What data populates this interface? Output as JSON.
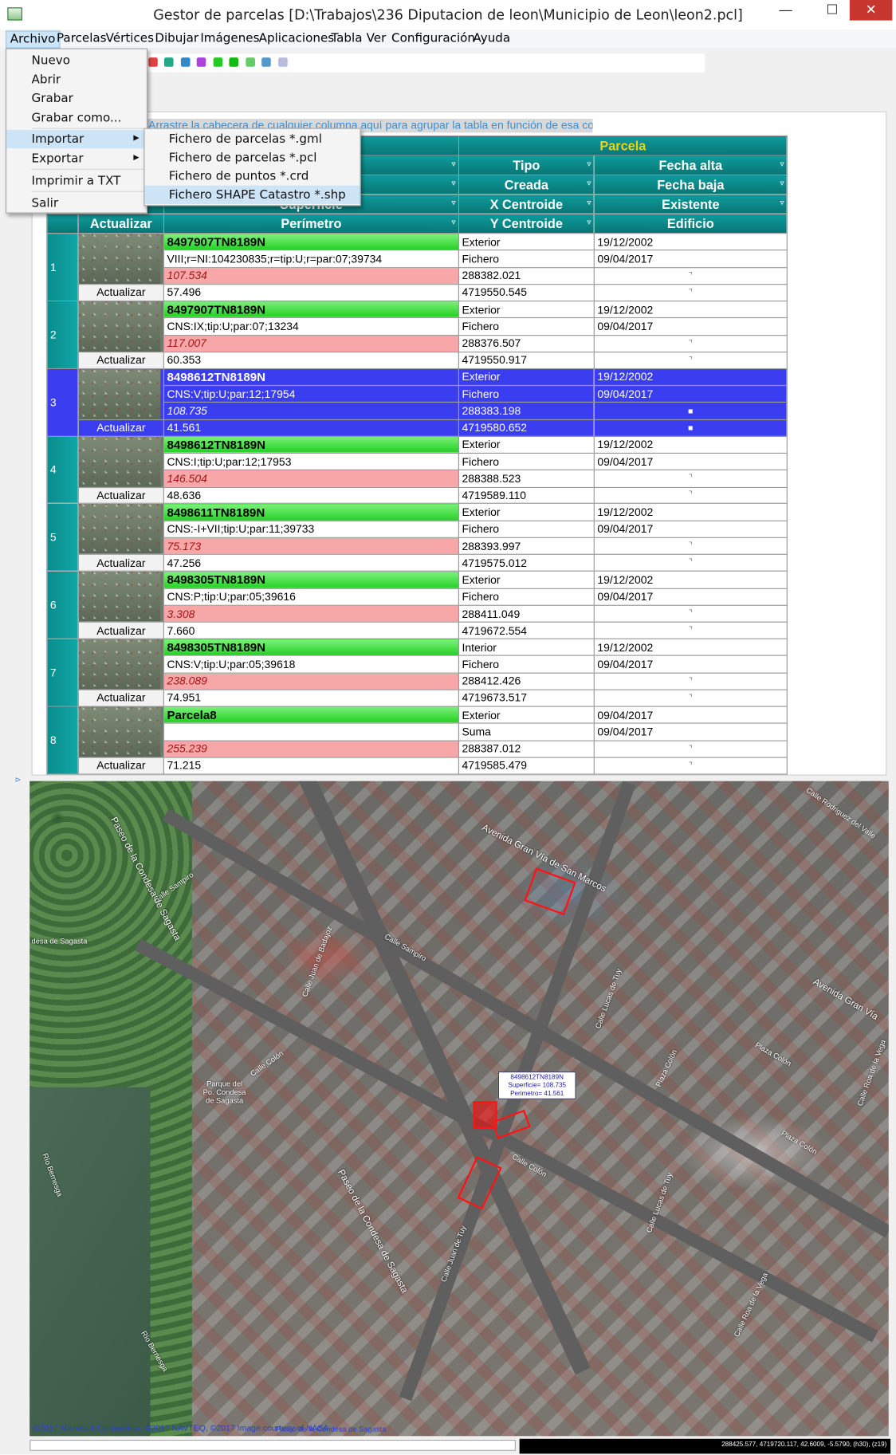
{
  "window": {
    "title": "Gestor de parcelas [D:\\Trabajos\\236 Diputacion de leon\\Municipio de Leon\\leon2.pcl]",
    "minimize": "—",
    "maximize": "☐",
    "close": "✕"
  },
  "menubar": [
    "Archivo",
    "Parcelas",
    "Vértices",
    "Dibujar",
    "Imágenes",
    "Aplicaciones",
    "Tabla",
    "Ver",
    "Configuración",
    "Ayuda"
  ],
  "archivo_menu": {
    "items": [
      "Nuevo",
      "Abrir",
      "Grabar",
      "Grabar como...",
      "Importar",
      "Exportar",
      "Imprimir a TXT",
      "Salir"
    ],
    "highlighted": "Importar"
  },
  "importar_submenu": {
    "items": [
      "Fichero de parcelas *.gml",
      "Fichero de parcelas *.pcl",
      "Fichero de puntos *.crd",
      "Fichero SHAPE Catastro *.shp"
    ],
    "highlighted": "Fichero SHAPE Catastro *.shp"
  },
  "group_hint": "Arrastre la cabecera de cualquier columna aquí para agrupar la tabla en función de esa columna.",
  "grid": {
    "band": "Parcela",
    "headers": {
      "tipo": "Tipo",
      "fecha_alta": "Fecha alta",
      "creada": "Creada",
      "fecha_baja": "Fecha baja",
      "superficie": "Superficie",
      "x_centroide": "X Centroide",
      "existente": "Existente",
      "actualizar": "Actualizar",
      "perimetro": "Perímetro",
      "y_centroide": "Y Centroide",
      "edificio": "Edificio"
    },
    "rows": [
      {
        "n": "1",
        "ref": "8497907TN8189N",
        "desc": "VIII;r=NI:104230835;r=tip:U;r=par:07;39734",
        "area": "107.534",
        "perim": "57.496",
        "tipo": "Exterior",
        "creada": "Fichero",
        "x": "288382.021",
        "y": "4719550.545",
        "alta": "19/12/2002",
        "baja": "09/04/2017",
        "upd": "Actualizar",
        "chk1": "⌝",
        "chk2": "⌝"
      },
      {
        "n": "2",
        "ref": "8497907TN8189N",
        "desc": "CNS:IX;tip:U;par:07;13234",
        "area": "117.007",
        "perim": "60.353",
        "tipo": "Exterior",
        "creada": "Fichero",
        "x": "288376.507",
        "y": "4719550.917",
        "alta": "19/12/2002",
        "baja": "09/04/2017",
        "upd": "Actualizar",
        "chk1": "⌝",
        "chk2": "⌝"
      },
      {
        "n": "3",
        "ref": "8498612TN8189N",
        "desc": "CNS:V;tip:U;par:12;17954",
        "area": "108.735",
        "perim": "41.561",
        "tipo": "Exterior",
        "creada": "Fichero",
        "x": "288383.198",
        "y": "4719580.652",
        "alta": "19/12/2002",
        "baja": "09/04/2017",
        "upd": "Actualizar",
        "chk1": "■",
        "chk2": "■"
      },
      {
        "n": "4",
        "ref": "8498612TN8189N",
        "desc": "CNS:I;tip:U;par:12;17953",
        "area": "146.504",
        "perim": "48.636",
        "tipo": "Exterior",
        "creada": "Fichero",
        "x": "288388.523",
        "y": "4719589.110",
        "alta": "19/12/2002",
        "baja": "09/04/2017",
        "upd": "Actualizar",
        "chk1": "⌝",
        "chk2": "⌝"
      },
      {
        "n": "5",
        "ref": "8498611TN8189N",
        "desc": "CNS:-I+VII;tip:U;par:11;39733",
        "area": "75.173",
        "perim": "47.256",
        "tipo": "Exterior",
        "creada": "Fichero",
        "x": "288393.997",
        "y": "4719575.012",
        "alta": "19/12/2002",
        "baja": "09/04/2017",
        "upd": "Actualizar",
        "chk1": "⌝",
        "chk2": "⌝"
      },
      {
        "n": "6",
        "ref": "8498305TN8189N",
        "desc": "CNS:P;tip:U;par:05;39616",
        "area": "3.308",
        "perim": "7.660",
        "tipo": "Exterior",
        "creada": "Fichero",
        "x": "288411.049",
        "y": "4719672.554",
        "alta": "19/12/2002",
        "baja": "09/04/2017",
        "upd": "Actualizar",
        "chk1": "⌝",
        "chk2": "⌝"
      },
      {
        "n": "7",
        "ref": "8498305TN8189N",
        "desc": "CNS:V;tip:U;par:05;39618",
        "area": "238.089",
        "perim": "74.951",
        "tipo": "Interior",
        "creada": "Fichero",
        "x": "288412.426",
        "y": "4719673.517",
        "alta": "19/12/2002",
        "baja": "09/04/2017",
        "upd": "Actualizar",
        "chk1": "⌝",
        "chk2": "⌝"
      },
      {
        "n": "8",
        "ref": "Parcela8",
        "desc": "",
        "area": "255.239",
        "perim": "71.215",
        "tipo": "Exterior",
        "creada": "Suma",
        "x": "288387.012",
        "y": "4719585.479",
        "alta": "09/04/2017",
        "baja": "09/04/2017",
        "upd": "Actualizar",
        "chk1": "⌝",
        "chk2": "⌝"
      }
    ],
    "selected_row": "3"
  },
  "map": {
    "streets": [
      "Avenida Gran Vía de San Marcos",
      "Calle Rodriguez del Valle",
      "Calle Sampiro",
      "Calle Sampiro",
      "Paseo de la Condesa de Sagasta",
      "desa de Sagasta",
      "Calle Juan de Badajoz",
      "Calle Lucas de Tuy",
      "Avenida Gran Vía",
      "Calle Colón",
      "Plaza Colón",
      "Plaza Colón",
      "Calle Roa de la Vega",
      "Calle Colón",
      "Plaza Colón",
      "Calle Lucas de Tuy",
      "Paseo de la Condesa de Sagasta",
      "Calle Roa de la Vega",
      "Río Bernesga",
      "Río Bernesga",
      "Parque del Po. Condesa de Sagasta",
      "Calle Juan de Tuy"
    ],
    "tooltip": {
      "ref": "8498612TN8189N",
      "superficie": "Superficie= 108.735",
      "perimetro": "Perimetro= 41.561"
    },
    "copyright": "©2017 Microsoft Corporation, ©2017 NAVTEQ, ©2017 Image courtesy of NASA",
    "bottom_street": "Paseo de la Condesa de Sagasta"
  },
  "status": {
    "coords": "288425.577, 4719720.117, 42.6009, -5.5790, (h30), (z19)"
  }
}
